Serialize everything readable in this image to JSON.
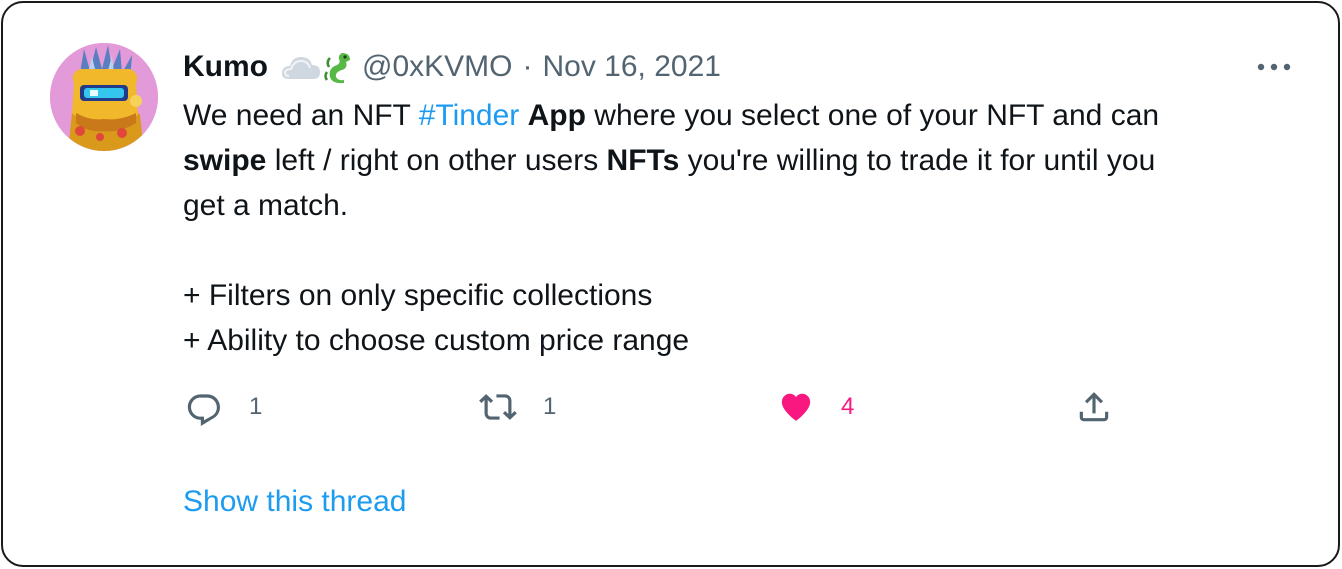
{
  "author": {
    "display_name": "Kumo",
    "badges": [
      "cloud-icon",
      "dragon-icon"
    ],
    "handle": "@0xKVMO",
    "separator": "·",
    "date": "Nov 16, 2021"
  },
  "tweet": {
    "line1": {
      "t1": "We need an NFT ",
      "hashtag": "#Tinder",
      "t2": " ",
      "b1": "App",
      "t3": " where you select one of your NFT and can"
    },
    "line2": {
      "b1": "swipe",
      "t1": " left / right on other users ",
      "b2": "NFTs",
      "t2": " you're willing to trade it for until you"
    },
    "line3": "get a match.",
    "list": [
      "+ Filters on only specific collections",
      "+ Ability to choose custom price range"
    ]
  },
  "actions": {
    "reply_count": "1",
    "retweet_count": "1",
    "like_count": "4",
    "liked": true
  },
  "show_thread_label": "Show this thread",
  "colors": {
    "accent": "#1d9bf0",
    "like": "#f91880",
    "text": "#0f1419",
    "muted": "#536471",
    "border": "#1a1a1a"
  }
}
